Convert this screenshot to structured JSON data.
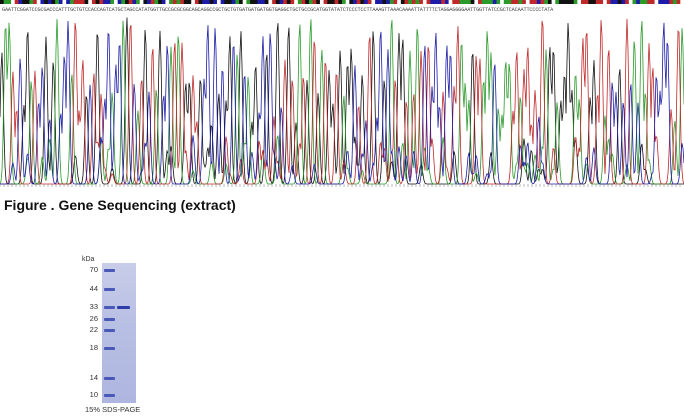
{
  "sequence": "GAATTCGGATCCGCGACCCATTTGCTGTCCACCAGTCATGCTAGCCATATGGTTGCCGCGCGGCAGCAGGCCGCTGCTGTGATGATGATGGTGAGGCTGCTGCCGCATGGTATATCTCCCTCCTTAAAGTTAAACAAAATTATTTTCTAGGAGGGGAATTGGTTATCCGCTCACAATTCCCCTATA",
  "trace_colors": {
    "A": "#2a9a2a",
    "C": "#1c1ca8",
    "G": "#111111",
    "T": "#c0282a"
  },
  "figure": {
    "caption": "Figure . Gene Sequencing (extract)"
  },
  "gel": {
    "unit_label": "kDa",
    "markers": [
      "70",
      "44",
      "33",
      "26",
      "22",
      "18",
      "14",
      "10"
    ],
    "caption": "15% SDS-PAGE",
    "sample_band_kda": "33"
  }
}
